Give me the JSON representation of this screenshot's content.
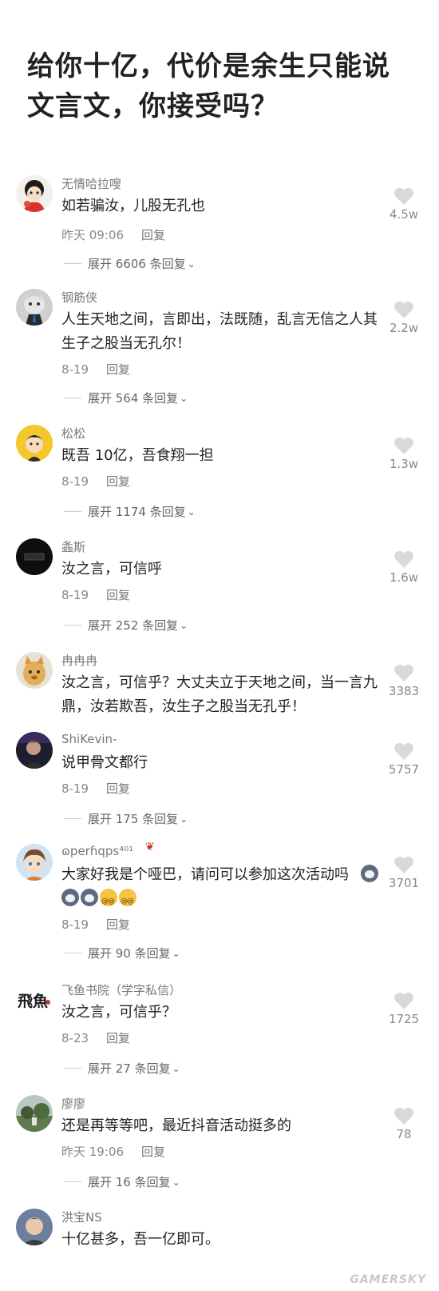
{
  "title": "给你十亿，代价是余生只能说文言文，你接受吗？",
  "labels": {
    "reply": "回复"
  },
  "comments": [
    {
      "username": "无情哈拉嗖",
      "text": "如若骗汝，儿股无孔也",
      "date": "昨天 09:06",
      "expand": "展开 6606 条回复",
      "likes": "4.5w",
      "avatar": "cartoon-avatar"
    },
    {
      "username": "钢筋侠",
      "text": "人生天地之间，言即出，法既随，乱言无信之人其生子之股当无孔尔！",
      "date": "8-19",
      "expand": "展开 564 条回复",
      "likes": "2.2w",
      "avatar": "cat-avatar"
    },
    {
      "username": "松松",
      "text": "既吾 10亿，吾食翔一担",
      "date": "8-19",
      "expand": "展开 1174 条回复",
      "likes": "1.3w",
      "avatar": "boy-avatar"
    },
    {
      "username": "螽斯",
      "text": "汝之言，可信呼",
      "date": "8-19",
      "expand": "展开 252 条回复",
      "likes": "1.6w",
      "avatar": "dark-avatar"
    },
    {
      "username": "冉冉冉",
      "text": "汝之言，可信乎？大丈夫立于天地之间，当一言九鼎，汝若欺吾，汝生子之股当无孔乎！",
      "date": "",
      "expand": "",
      "likes": "3383",
      "avatar": "dog-avatar"
    },
    {
      "username": "ShiKevin-",
      "text": "说甲骨文都行",
      "date": "8-19",
      "expand": "展开 175 条回复",
      "likes": "5757",
      "avatar": "photo-avatar"
    },
    {
      "username": "ɷperɦqps⁴⁰¹",
      "text": "大家好我是个哑巴，请问可以参加这次活动吗",
      "date": "8-19",
      "expand": "展开 90 条回复",
      "likes": "3701",
      "avatar": "anime-avatar"
    },
    {
      "username": "飞鱼书院（学字私信）",
      "text": "汝之言，可信乎？",
      "date": "8-23",
      "expand": "展开 27 条回复",
      "likes": "1725",
      "avatar": "calligraphy-avatar"
    },
    {
      "username": "廖廖",
      "text": "还是再等等吧，最近抖音活动挺多的",
      "date": "昨天 19:06",
      "expand": "展开 16 条回复",
      "likes": "78",
      "avatar": "landscape-avatar"
    },
    {
      "username": "洪宝NS",
      "text": "十亿甚多，吾一亿即可。",
      "date": "",
      "expand": "",
      "likes": "",
      "avatar": "man-avatar"
    }
  ],
  "emoji_row": [
    "husky-emoji",
    "husky-emoji",
    "husky-emoji",
    "dizzy-emoji",
    "dizzy-emoji"
  ],
  "avatar_calligraphy_text": "飛魚",
  "watermark": "GAMERSKY"
}
